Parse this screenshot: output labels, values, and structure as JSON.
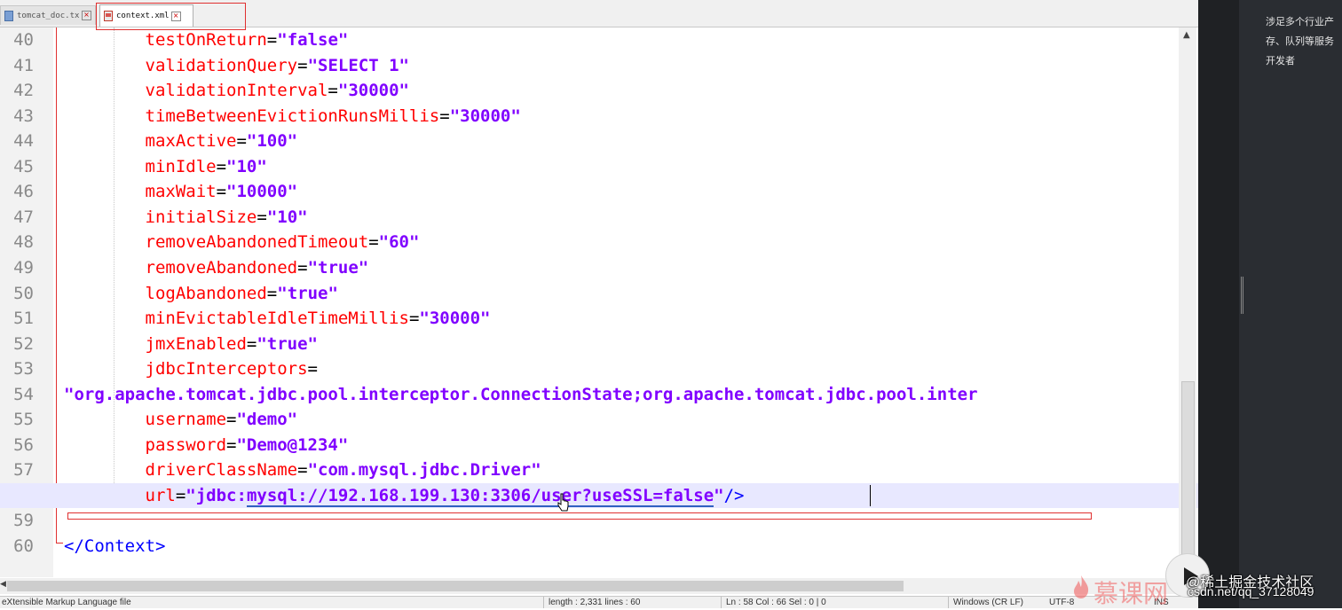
{
  "tabs": [
    {
      "label": "tomcat_doc.txt",
      "active": false
    },
    {
      "label": "context.xml",
      "active": true
    }
  ],
  "lines": [
    {
      "num": "40",
      "indent": "        ",
      "attr": "testOnReturn",
      "value": "\"false\""
    },
    {
      "num": "41",
      "indent": "        ",
      "attr": "validationQuery",
      "value": "\"SELECT 1\""
    },
    {
      "num": "42",
      "indent": "        ",
      "attr": "validationInterval",
      "value": "\"30000\""
    },
    {
      "num": "43",
      "indent": "        ",
      "attr": "timeBetweenEvictionRunsMillis",
      "value": "\"30000\""
    },
    {
      "num": "44",
      "indent": "        ",
      "attr": "maxActive",
      "value": "\"100\""
    },
    {
      "num": "45",
      "indent": "        ",
      "attr": "minIdle",
      "value": "\"10\""
    },
    {
      "num": "46",
      "indent": "        ",
      "attr": "maxWait",
      "value": "\"10000\""
    },
    {
      "num": "47",
      "indent": "        ",
      "attr": "initialSize",
      "value": "\"10\""
    },
    {
      "num": "48",
      "indent": "        ",
      "attr": "removeAbandonedTimeout",
      "value": "\"60\""
    },
    {
      "num": "49",
      "indent": "        ",
      "attr": "removeAbandoned",
      "value": "\"true\""
    },
    {
      "num": "50",
      "indent": "        ",
      "attr": "logAbandoned",
      "value": "\"true\""
    },
    {
      "num": "51",
      "indent": "        ",
      "attr": "minEvictableIdleTimeMillis",
      "value": "\"30000\""
    },
    {
      "num": "52",
      "indent": "        ",
      "attr": "jmxEnabled",
      "value": "\"true\""
    },
    {
      "num": "53",
      "indent": "        ",
      "attr": "jdbcInterceptors",
      "value": "",
      "eq": "="
    },
    {
      "num": "54",
      "indent": "",
      "attr": "",
      "value": "\"org.apache.tomcat.jdbc.pool.interceptor.ConnectionState;org.apache.tomcat.jdbc.pool.inter",
      "eq": ""
    },
    {
      "num": "55",
      "indent": "        ",
      "attr": "username",
      "value": "\"demo\""
    },
    {
      "num": "56",
      "indent": "        ",
      "attr": "password",
      "value": "\"Demo@1234\""
    },
    {
      "num": "57",
      "indent": "        ",
      "attr": "driverClassName",
      "value": "\"com.mysql.jdbc.Driver\""
    },
    {
      "num": "58",
      "indent": "        ",
      "attr": "url",
      "value_a": "\"jdbc:",
      "value_b": "mysql://192.168.199.130:3306/user?useSSL=false",
      "value_c": "\"",
      "tail": "/>"
    },
    {
      "num": "59",
      "indent": "",
      "attr": "",
      "value": ""
    },
    {
      "num": "60",
      "indent": "",
      "close_tag": "</Context>"
    }
  ],
  "status": {
    "left": "eXtensible Markup Language file",
    "length": "length : 2,331   lines : 60",
    "position": "Ln : 58   Col : 66   Sel : 0 | 0",
    "eol": "Windows (CR LF)",
    "encoding": "UTF-8",
    "mode": "INS"
  },
  "right_panel": {
    "line1": "涉足多个行业产",
    "line2": "存、队列等服务",
    "line3": "开发者"
  },
  "watermarks": {
    "brand": "慕课网",
    "juejin": "@稀土掘金技术社区",
    "csdn": "csdn.net/qq_37128049"
  },
  "colors": {
    "attribute": "#ff0000",
    "value": "#8000ff",
    "tag": "#0000ff",
    "current_line": "#e8e8ff",
    "highlight_box": "#e03030"
  }
}
